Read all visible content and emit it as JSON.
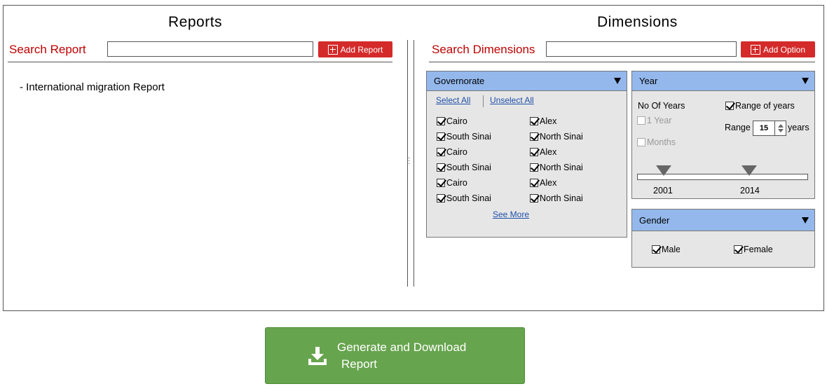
{
  "reports": {
    "title": "Reports",
    "search_label": "Search Report",
    "search_value": "",
    "add_button_label": "Add Report",
    "items": [
      "- International migration Report"
    ]
  },
  "dimensions": {
    "title": "Dimensions",
    "search_label": "Search Dimensions",
    "search_value": "",
    "add_button_label": "Add Option"
  },
  "governorate": {
    "title": "Governorate",
    "select_all": "Select All",
    "unselect_all": "Unselect All",
    "options": [
      {
        "label": "Cairo",
        "checked": true
      },
      {
        "label": "Alex",
        "checked": true
      },
      {
        "label": "South Sinai",
        "checked": true
      },
      {
        "label": "North Sinai",
        "checked": true
      },
      {
        "label": "Cairo",
        "checked": true
      },
      {
        "label": "Alex",
        "checked": true
      },
      {
        "label": "South Sinai",
        "checked": true
      },
      {
        "label": "North Sinai",
        "checked": true
      },
      {
        "label": "Cairo",
        "checked": true
      },
      {
        "label": "Alex",
        "checked": true
      },
      {
        "label": "South Sinai",
        "checked": true
      },
      {
        "label": "North Sinai",
        "checked": true
      }
    ],
    "see_more": "See More"
  },
  "year": {
    "title": "Year",
    "no_of_years_label": "No Of Years",
    "range_of_years_label": "Range of years",
    "range_of_years_checked": true,
    "one_year_label": "1 Year",
    "months_label": "Months",
    "range_label": "Range",
    "range_value": "15",
    "years_label": "years",
    "start_year": "2001",
    "end_year": "2014"
  },
  "gender": {
    "title": "Gender",
    "male_label": "Male",
    "female_label": "Female"
  },
  "generate_button": {
    "line1": "Generate and Download",
    "line2": "Report",
    "icon": "download-icon"
  },
  "colors": {
    "accent_red": "#d42a2a",
    "label_red": "#c00000",
    "panel_header_blue": "#94b8ec",
    "panel_body_gray": "#e6e6e6",
    "generate_green": "#67a44e",
    "link_blue": "#1e4fa8"
  }
}
